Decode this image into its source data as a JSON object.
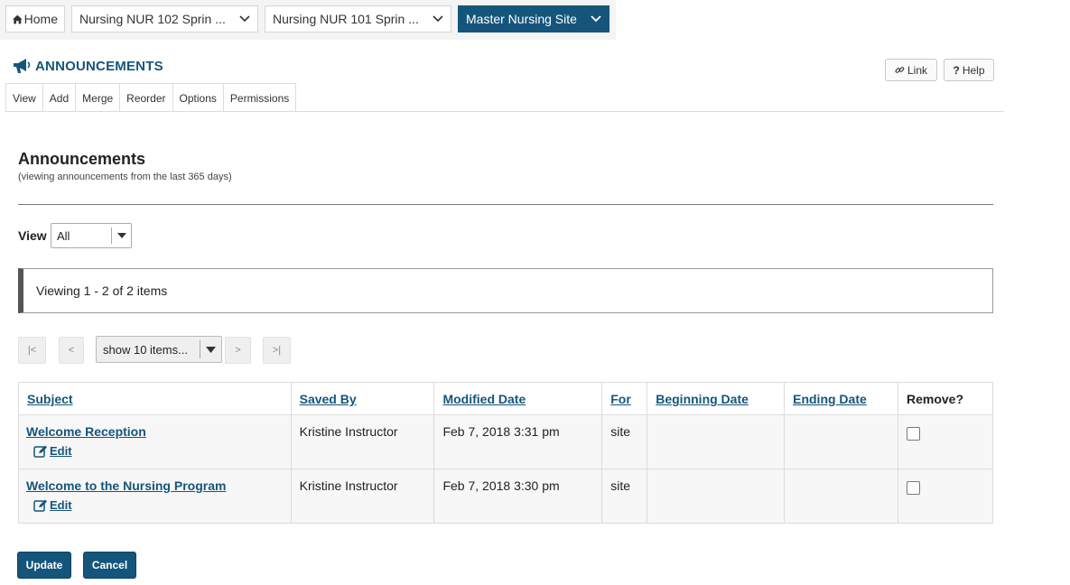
{
  "nav": {
    "home_label": "Home",
    "sites": [
      {
        "label": "Nursing NUR 102 Sprin ..."
      },
      {
        "label": "Nursing NUR 101 Sprin ..."
      },
      {
        "label": "Master Nursing Site"
      }
    ]
  },
  "tool": {
    "title": "ANNOUNCEMENTS",
    "link_label": "Link",
    "help_label": "Help",
    "menu": [
      "View",
      "Add",
      "Merge",
      "Reorder",
      "Options",
      "Permissions"
    ]
  },
  "page": {
    "heading": "Announcements",
    "subheading": "(viewing announcements from the last 365 days)",
    "view_label": "View",
    "view_value": "All",
    "viewing_text": "Viewing 1 - 2 of 2 items"
  },
  "pager": {
    "first": "|<",
    "prev": "<",
    "page_size": "show 10 items...",
    "next": ">",
    "last": ">|"
  },
  "table": {
    "headers": {
      "subject": "Subject",
      "saved_by": "Saved By",
      "modified": "Modified Date",
      "for": "For",
      "begin": "Beginning Date",
      "end": "Ending Date",
      "remove": "Remove?"
    },
    "edit_label": "Edit",
    "rows": [
      {
        "subject": "Welcome Reception",
        "saved_by": "Kristine Instructor",
        "modified": "Feb 7, 2018 3:31 pm",
        "for": "site",
        "begin": "",
        "end": ""
      },
      {
        "subject": "Welcome to the Nursing Program",
        "saved_by": "Kristine Instructor",
        "modified": "Feb 7, 2018 3:30 pm",
        "for": "site",
        "begin": "",
        "end": ""
      }
    ]
  },
  "actions": {
    "update": "Update",
    "cancel": "Cancel"
  },
  "colors": {
    "accent": "#15557b"
  }
}
